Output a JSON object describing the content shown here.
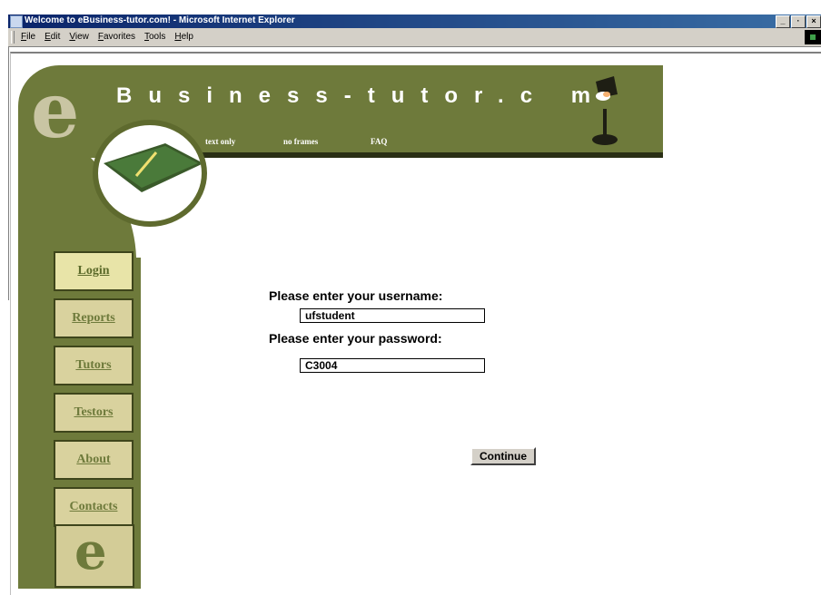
{
  "window": {
    "title": "Welcome to eBusiness-tutor.com! - Microsoft Internet Explorer",
    "controls": [
      "_",
      "·",
      "×"
    ]
  },
  "menu": {
    "items": [
      "File",
      "Edit",
      "View",
      "Favorites",
      "Tools",
      "Help"
    ]
  },
  "header": {
    "site_title": "Business-tutor.c m",
    "links": [
      "text only",
      "no frames",
      "FAQ"
    ]
  },
  "sidebar": {
    "items": [
      "Login",
      "Reports",
      "Tutors",
      "Testors",
      "About",
      "Contacts"
    ],
    "active": "Login"
  },
  "form": {
    "username_label": "Please enter your username:",
    "username_value": "ufstudent",
    "password_label": "Please enter your password:",
    "password_value": "C3004",
    "continue_label": "Continue"
  },
  "colors": {
    "olive": "#6e7a3b",
    "nav_button": "#d9d29e",
    "titlebar": "#0a246a"
  }
}
